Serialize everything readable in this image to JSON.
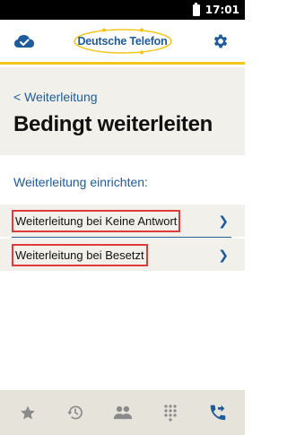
{
  "status_bar": {
    "time": "17:01"
  },
  "header": {
    "brand": "Deutsche Telefon",
    "icons": {
      "left": "cloud-check-icon",
      "right": "gear-icon"
    }
  },
  "page": {
    "breadcrumb": "< Weiterleitung",
    "title": "Bedingt weiterleiten"
  },
  "section": {
    "label": "Weiterleitung einrichten:",
    "items": [
      {
        "label": "Weiterleitung bei Keine Antwort"
      },
      {
        "label": "Weiterleitung bei Besetzt"
      }
    ]
  },
  "bottom_nav": {
    "items": [
      "star-icon",
      "history-icon",
      "contacts-icon",
      "dialpad-icon",
      "call-forward-icon"
    ],
    "active": "call-forward-icon"
  },
  "colors": {
    "accent": "#1e5b9c",
    "brand_yellow": "#f5c61a",
    "highlight_box": "#e03a3a"
  }
}
